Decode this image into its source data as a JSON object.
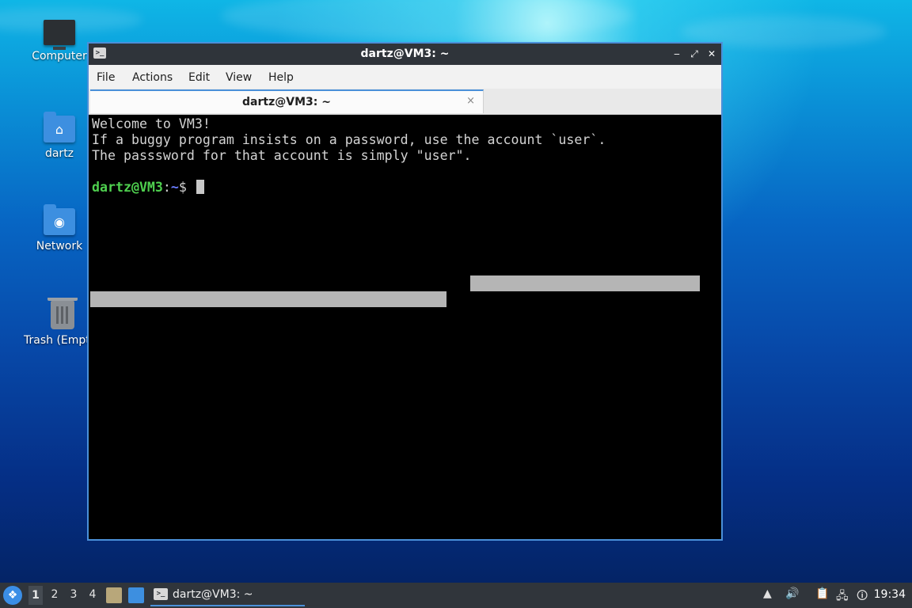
{
  "desktop": {
    "icons": [
      {
        "label": "Computer",
        "icon": "computer-icon"
      },
      {
        "label": "dartz",
        "icon": "home-folder-icon"
      },
      {
        "label": "Network",
        "icon": "network-folder-icon"
      },
      {
        "label": "Trash (Empt",
        "icon": "trash-icon"
      }
    ]
  },
  "window": {
    "title": "dartz@VM3: ~",
    "menu": [
      "File",
      "Actions",
      "Edit",
      "View",
      "Help"
    ],
    "tab_label": "dartz@VM3: ~",
    "tab_close": "×",
    "controls": {
      "minimize": "‒",
      "maximize": "⤢",
      "close": "✕"
    }
  },
  "terminal": {
    "lines": [
      "Welcome to VM3!",
      "If a buggy program insists on a password, use the account `user`.",
      "The passsword for that account is simply \"user\"."
    ],
    "prompt_user": "dartz@VM3",
    "prompt_sep": ":",
    "prompt_path": "~",
    "prompt_symbol": "$"
  },
  "taskbar": {
    "workspaces": [
      "1",
      "2",
      "3",
      "4"
    ],
    "active_workspace": "1",
    "task_label": "dartz@VM3: ~",
    "clock": "19:34"
  },
  "colors": {
    "accent": "#4a90d9",
    "prompt_green": "#4fd04f",
    "prompt_blue": "#6a7cff",
    "terminal_bg": "#000000",
    "taskbar_bg": "#30353b"
  }
}
